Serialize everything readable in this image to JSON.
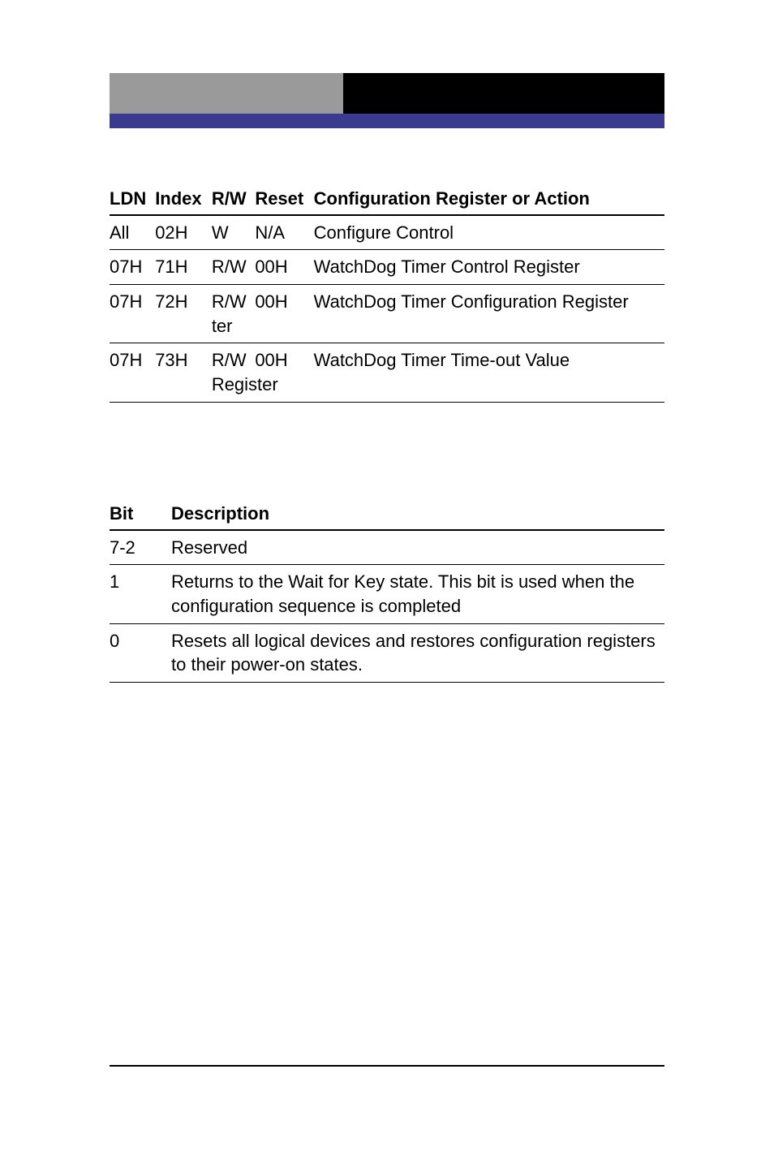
{
  "regtable": {
    "headers": [
      "LDN",
      "Index",
      "R/W",
      "Reset",
      "Configuration Register or Action"
    ],
    "rows": [
      {
        "ldn": "All",
        "index": "02H",
        "rw": "W",
        "reset": "N/A",
        "desc": "Configure Control"
      },
      {
        "ldn": "07H",
        "index": "71H",
        "rw": "R/W",
        "reset": "00H",
        "desc": "WatchDog Timer Control Register"
      },
      {
        "ldn": "07H",
        "index": "72H",
        "rw": "R/W",
        "reset": "00H",
        "desc": "WatchDog Timer Configuration Register",
        "wrap_after_rw": "ter"
      },
      {
        "ldn": "07H",
        "index": "73H",
        "rw": "R/W",
        "reset": "00H",
        "desc": "WatchDog Timer Time-out Value",
        "wrap_after_rw": "Register"
      }
    ]
  },
  "bittable": {
    "headers": [
      "Bit",
      "Description"
    ],
    "rows": [
      {
        "bit": "7-2",
        "desc": "Reserved"
      },
      {
        "bit": "1",
        "desc": "Returns to the Wait for Key state. This bit is used when the configuration sequence is completed"
      },
      {
        "bit": "0",
        "desc": "Resets all logical devices and restores configuration registers to their power-on states."
      }
    ]
  }
}
